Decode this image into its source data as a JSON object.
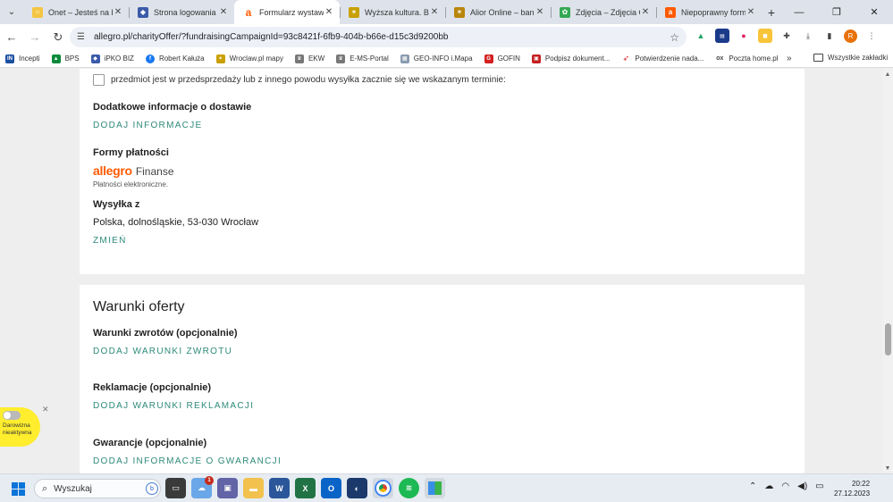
{
  "browser": {
    "tabs": [
      {
        "title": "Onet – Jesteś na bieżąco",
        "fav_color": "#f4c542",
        "fav_glyph": "○",
        "active": false
      },
      {
        "title": "Strona logowania | iPKO",
        "fav_color": "#3b5ba9",
        "fav_glyph": "◆",
        "active": false
      },
      {
        "title": "Formularz wystawiania",
        "fav_color": "#ff5a00",
        "fav_glyph": "a",
        "active": true
      },
      {
        "title": "Wyższa kultura. Bank",
        "fav_color": "#c8a000",
        "fav_glyph": "✶",
        "active": false
      },
      {
        "title": "Alior Online – bankowość",
        "fav_color": "#b8860b",
        "fav_glyph": "✶",
        "active": false
      },
      {
        "title": "Zdjęcia – Zdjęcia Google",
        "fav_color": "#34a853",
        "fav_glyph": "✿",
        "active": false
      },
      {
        "title": "Niepoprawny formularz",
        "fav_color": "#ff5a00",
        "fav_glyph": "a",
        "active": false
      }
    ],
    "url": "allegro.pl/charityOffer/?fundraisingCampaignId=93c8421f-6fb9-404b-b66e-d15c3d9200bb",
    "profile_initial": "R"
  },
  "bookmarks": {
    "items": [
      {
        "label": "Incepti",
        "color": "#1a4fa0",
        "glyph": "IN"
      },
      {
        "label": "BPS",
        "color": "#0a8a3a",
        "glyph": "▲"
      },
      {
        "label": "iPKO BIZ",
        "color": "#3b5ba9",
        "glyph": "◆"
      },
      {
        "label": "Robert Kałuża",
        "color": "#1877f2",
        "glyph": "f"
      },
      {
        "label": "Wroclaw.pl mapy",
        "color": "#c9a000",
        "glyph": "✶"
      },
      {
        "label": "EKW",
        "color": "#777777",
        "glyph": "♛"
      },
      {
        "label": "E-MS-Portal",
        "color": "#777777",
        "glyph": "♛"
      },
      {
        "label": "GEO-INFO i.Mapa",
        "color": "#8a9bb0",
        "glyph": "▦"
      },
      {
        "label": "GOFIN",
        "color": "#d32020",
        "glyph": "G"
      },
      {
        "label": "Podpisz dokument...",
        "color": "#c42020",
        "glyph": "▣"
      },
      {
        "label": "Potwierdzenie nada...",
        "color": "#d32020",
        "glyph": "➶"
      },
      {
        "label": "Poczta home.pl",
        "color": "#444444",
        "glyph": "ox"
      }
    ],
    "all_bookmarks": "Wszystkie zakładki"
  },
  "form": {
    "preorder_checkbox_label": "przedmiot jest w przedsprzedaży lub z innego powodu wysyłka zacznie się we wskazanym terminie:",
    "delivery_info_heading": "Dodatkowe informacje o dostawie",
    "delivery_info_link": "DODAJ INFORMACJE",
    "payment_heading": "Formy płatności",
    "payment_logo_brand": "allegro",
    "payment_logo_suffix": "Finanse",
    "payment_sub": "Płatności elektroniczne.",
    "shipping_heading": "Wysyłka z",
    "shipping_location": "Polska, dolnośląskie, 53-030 Wrocław",
    "shipping_change_link": "ZMIEŃ",
    "offer_terms_title": "Warunki oferty",
    "returns_heading": "Warunki zwrotów (opcjonalnie)",
    "returns_link": "DODAJ WARUNKI ZWROTU",
    "complaints_heading": "Reklamacje (opcjonalnie)",
    "complaints_link": "DODAJ WARUNKI REKLAMACJI",
    "warranty_heading": "Gwarancje (opcjonalnie)",
    "warranty_link": "DODAJ INFORMACJE O GWARANCJI"
  },
  "donation_badge": {
    "label_line1": "Darowizna",
    "label_line2": "nieaktywna",
    "toggle_on": false
  },
  "taskbar": {
    "search_placeholder": "Wyszukaj",
    "weather_badge": "1",
    "time": "20:22",
    "date": "27.12.2023"
  },
  "colors": {
    "accent_link": "#2e8a7a",
    "allegro_orange": "#ff5a00",
    "donation_yellow": "#ffed2e"
  }
}
